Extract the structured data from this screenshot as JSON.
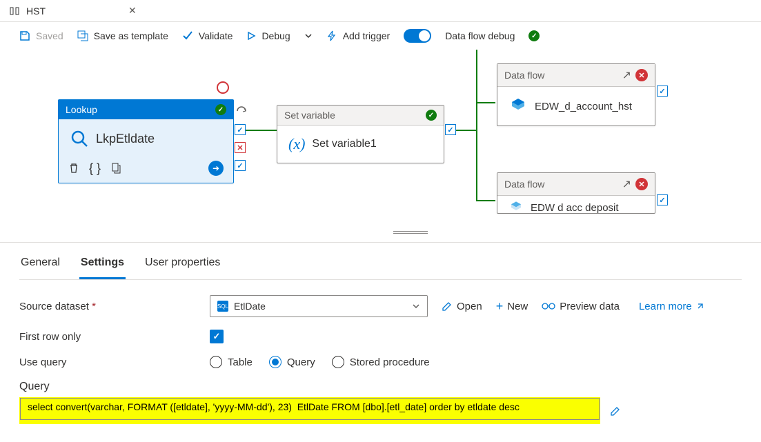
{
  "tab": {
    "title": "HST"
  },
  "toolbar": {
    "saved": "Saved",
    "save_template": "Save as template",
    "validate": "Validate",
    "debug": "Debug",
    "add_trigger": "Add trigger",
    "data_flow_debug": "Data flow debug"
  },
  "nodes": {
    "lookup": {
      "type": "Lookup",
      "name": "LkpEtldate"
    },
    "setvar": {
      "type": "Set variable",
      "name": "Set variable1"
    },
    "df1": {
      "type": "Data flow",
      "name": "EDW_d_account_hst"
    },
    "df2": {
      "type": "Data flow",
      "name": "EDW d acc deposit"
    }
  },
  "prop_tabs": {
    "general": "General",
    "settings": "Settings",
    "user_props": "User properties"
  },
  "form": {
    "source_dataset_label": "Source dataset",
    "source_dataset_value": "EtlDate",
    "open": "Open",
    "new": "New",
    "preview_data": "Preview data",
    "learn_more": "Learn more",
    "first_row_only": "First row only",
    "use_query": "Use query",
    "radio_table": "Table",
    "radio_query": "Query",
    "radio_sp": "Stored procedure",
    "query_label": "Query",
    "query_value": "select convert(varchar, FORMAT ([etldate], 'yyyy-MM-dd'), 23)  EtlDate FROM [dbo].[etl_date] order by etldate desc"
  }
}
